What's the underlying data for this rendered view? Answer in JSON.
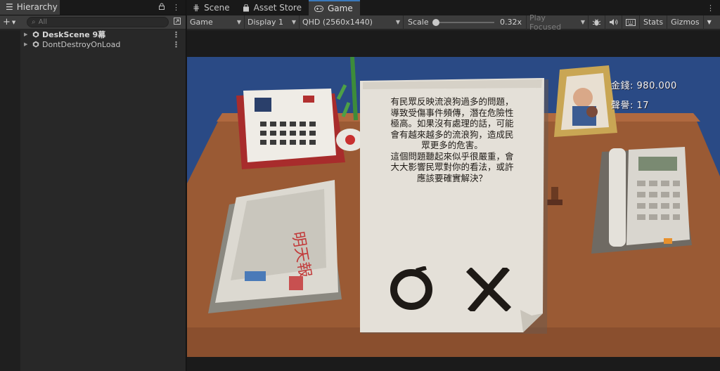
{
  "hierarchy": {
    "tab_label": "Hierarchy",
    "search_placeholder": "All",
    "items": [
      {
        "label": "DeskScene 9幕"
      },
      {
        "label": "DontDestroyOnLoad"
      }
    ]
  },
  "tabs": [
    {
      "label": "Scene",
      "icon": "scene-grid-icon"
    },
    {
      "label": "Asset Store",
      "icon": "store-bag-icon"
    },
    {
      "label": "Game",
      "icon": "gamepad-icon"
    }
  ],
  "toolbar": {
    "view_mode": "Game",
    "display": "Display 1",
    "resolution": "QHD (2560x1440)",
    "scale_label": "Scale",
    "scale_value": "0.32x",
    "scale_fraction": 0.03,
    "play_mode": "Play Focused",
    "stats_label": "Stats",
    "gizmos_label": "Gizmos"
  },
  "game": {
    "hud": {
      "money_label": "金錢:",
      "money_value": "980.000",
      "reputation_label": "聲譽:",
      "reputation_value": "17"
    },
    "letter": {
      "paragraph_1": "有民眾反映流浪狗過多的問題，導致受傷事件頻傳，潛在危險性極高。如果沒有處理的話，可能會有越來越多的流浪狗，造成民眾更多的危害。",
      "paragraph_2": "這個問題聽起來似乎很嚴重，會大大影響民眾對你的看法，或許應該要確實解決？"
    },
    "newspaper_headline": "明天報"
  },
  "colors": {
    "editor_bg": "#282828",
    "tab_accent": "#3a79bb",
    "game_wall": "#2a4a85",
    "desk_wood": "#9a5a34",
    "paper": "#e4e0d8",
    "ink": "#1e1a16"
  }
}
